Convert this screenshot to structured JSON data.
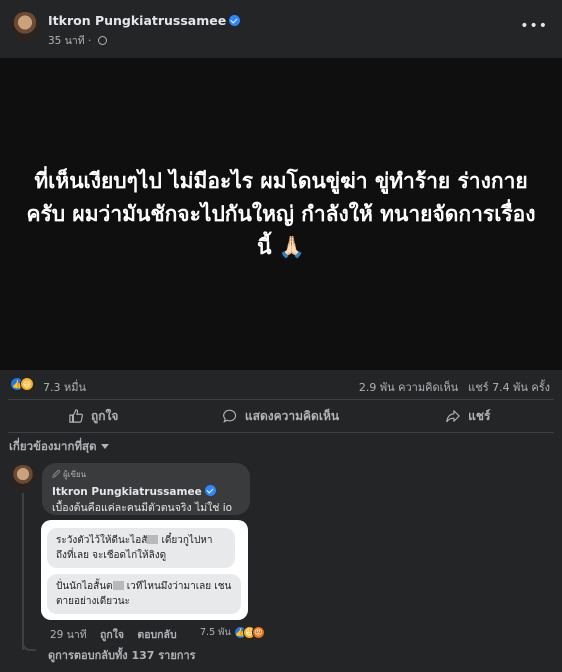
{
  "post": {
    "author": "Itkron Pungkiatrussamee",
    "time": "35 นาที",
    "more": "•••",
    "text": "ที่เห็นเงียบๆไป ไม่มีอะไร ผมโดนขู่ฆ่า ขู่ทำร้าย ร่างกายครับ ผมว่ามันชักจะไปกันใหญ่ กำลังให้ ทนายจัดการเรื่องนี้ 🙏🏻"
  },
  "stats": {
    "reactions": "7.3 หมื่น",
    "comments": "2.9 พัน ความคิดเห็น",
    "shares": "แชร์ 7.4 พัน ครั้ง"
  },
  "actions": {
    "like": "ถูกใจ",
    "comment": "แสดงความคิดเห็น",
    "share": "แชร์"
  },
  "sort_label": "เกี่ยวข้องมากที่สุด",
  "comment": {
    "badge": "🖉 ผู้เขียน",
    "author": "Itkron Pungkiatrussamee",
    "text": "เบื้องต้นคือแค่ละคนมีตัวตนจริง ไม่ใช่ io",
    "time": "29 นาที",
    "like": "ถูกใจ",
    "reply": "ตอบกลับ",
    "reaction_count": "7.5 พัน"
  },
  "overlay": {
    "msg1_a": "ระวังตัวไว้ให้ดีนะไอสั",
    "msg1_b": " เดี๋ยวกูไปหาถึงที่เลย จะเชือดไก่ให้ลิงดู",
    "msg2_a": "ปั่นนักไอสั้นต",
    "msg2_b": " เวทีไหนมึงว่ามาเลย เชนตายอย่างเดียวนะ"
  },
  "view_replies": "ดูการตอบกลับทั้ง 137 รายการ",
  "colors": {
    "background": "#242526",
    "post_bg": "#0f0f10",
    "like_blue": "#1877f2",
    "verified": "#2d88ff"
  }
}
